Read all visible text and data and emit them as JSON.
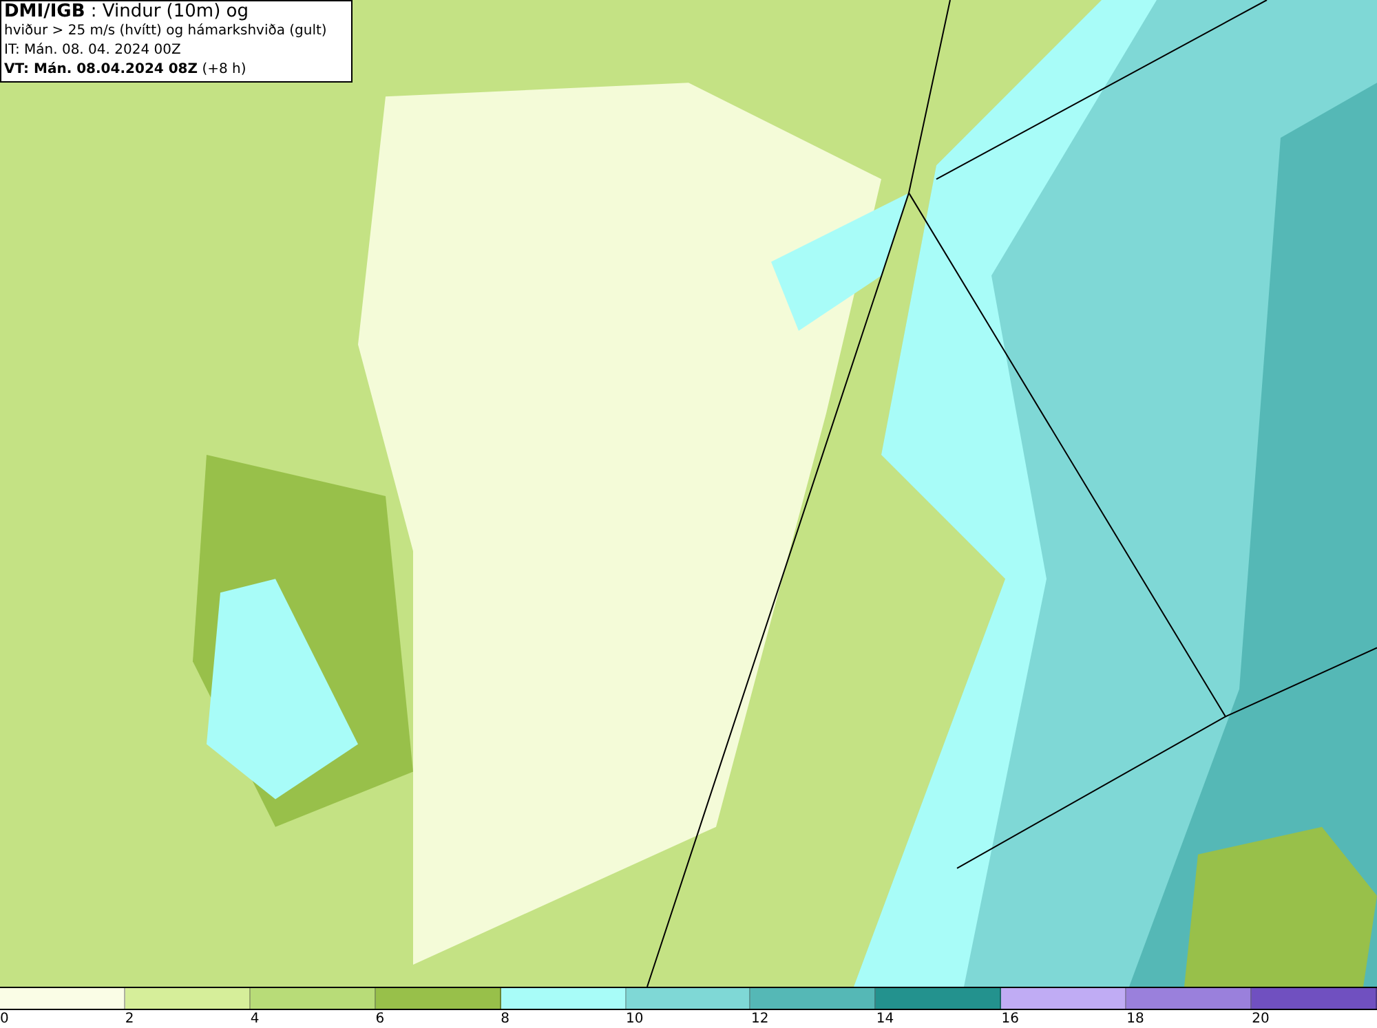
{
  "info_box": {
    "lines": [
      "**DMI/IGB** : Vindur (10m) og",
      "hviður > 25 m/s (hvítt) og hámarkshviða (gult)",
      "IT: Mán. 08. 04. 2024 00Z",
      "**VT: Mán. 08.04.2024 08Z** (+8 h)"
    ]
  },
  "legend": {
    "bins": [
      {
        "color": "#fafde6",
        "label": "0"
      },
      {
        "color": "#d6ee9a",
        "label": "2"
      },
      {
        "color": "#b8dc78",
        "label": "4"
      },
      {
        "color": "#98c04a",
        "label": "6"
      },
      {
        "color": "#a8fcf8",
        "label": "8"
      },
      {
        "color": "#7fd8d6",
        "label": "10"
      },
      {
        "color": "#55b8b6",
        "label": "12"
      },
      {
        "color": "#23928e",
        "label": "14"
      },
      {
        "color": "#c0acf4",
        "label": "16"
      },
      {
        "color": "#9a80dc",
        "label": "18"
      },
      {
        "color": "#7050c0",
        "label": "20"
      }
    ]
  }
}
